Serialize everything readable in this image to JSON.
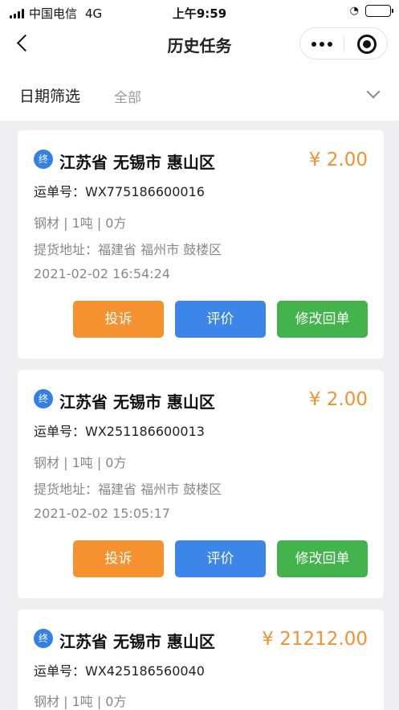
{
  "status_bar": {
    "carrier": "中国电信",
    "network": "4G",
    "time": "上午9:59",
    "lock_icon": "rotation-lock-icon",
    "battery_level": 1.0
  },
  "nav": {
    "title": "历史任务",
    "back_icon": "back-arrow-icon",
    "more_icon": "more-dots-icon",
    "close_icon": "target-circle-icon"
  },
  "filter": {
    "label": "日期筛选",
    "value": "全部",
    "chevron_icon": "chevron-down-icon"
  },
  "colors": {
    "badge": "#3380e6",
    "price": "#f39230",
    "complain_button": "#f5922f",
    "review_button": "#3b86e8",
    "edit_receipt_button": "#43b34b"
  },
  "tasks": [
    {
      "badge": "终",
      "region": "江苏省 无锡市 惠山区",
      "price": "¥ 2.00",
      "waybill": "运单号：WX775186600016",
      "cargo": "钢材 | 1吨 | 0方",
      "pickup": "提货地址：福建省 福州市 鼓楼区",
      "datetime": "2021-02-02 16:54:24",
      "buttons": [
        "投诉",
        "评价",
        "修改回单"
      ]
    },
    {
      "badge": "终",
      "region": "江苏省 无锡市 惠山区",
      "price": "¥ 2.00",
      "waybill": "运单号：WX251186600013",
      "cargo": "钢材 | 1吨 | 0方",
      "pickup": "提货地址：福建省 福州市 鼓楼区",
      "datetime": "2021-02-02 15:05:17",
      "buttons": [
        "投诉",
        "评价",
        "修改回单"
      ]
    },
    {
      "badge": "终",
      "region": "江苏省 无锡市 惠山区",
      "price": "¥ 21212.00",
      "waybill": "运单号：WX425186560040",
      "cargo": "钢材 | 1吨 | 0方"
    }
  ]
}
